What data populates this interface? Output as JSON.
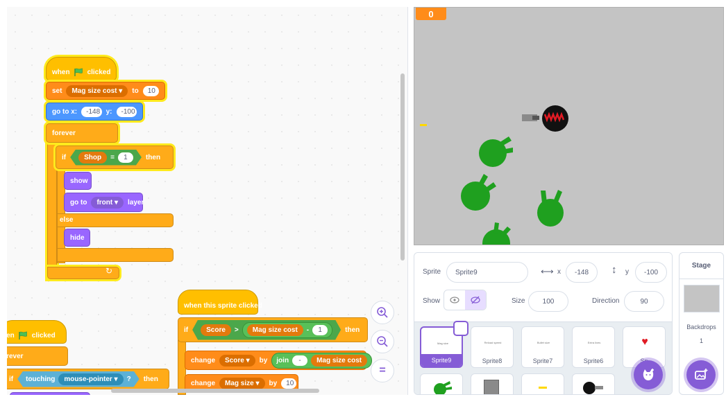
{
  "score_monitor": {
    "value": "0"
  },
  "scripts": {
    "script1": {
      "when_flag": {
        "when": "when",
        "clicked": "clicked"
      },
      "set": {
        "label": "set",
        "var": "Mag size cost ▾",
        "to": "to",
        "value": "10"
      },
      "goto": {
        "label": "go to x:",
        "x": "-148",
        "ylabel": "y:",
        "y": "-100"
      },
      "forever": "forever",
      "if": {
        "label": "if",
        "var": "Shop",
        "op": "=",
        "value": "1",
        "then": "then"
      },
      "show": "show",
      "goto_layer": {
        "label": "go to",
        "layer": "front ▾",
        "suffix": "layer"
      },
      "else": "else",
      "hide": "hide"
    },
    "script2": {
      "hat": "when this sprite clicked",
      "if": {
        "label": "if",
        "var": "Score",
        "op": ">",
        "var2": "Mag size cost",
        "op2": "-",
        "value": "1",
        "then": "then"
      },
      "change1": {
        "label": "change",
        "var": "Score ▾",
        "by": "by",
        "join": "join",
        "join_a": "-",
        "join_b": "Mag size cost"
      },
      "change2": {
        "label": "change",
        "var": "Mag size ▾",
        "by": "by",
        "value": "10"
      }
    },
    "script3": {
      "when": "hen",
      "clicked": "clicked",
      "forever": "orever",
      "if": {
        "label": "if",
        "touching": "touching",
        "target": "mouse-pointer ▾",
        "q": "?",
        "then": "then"
      }
    }
  },
  "zoom": {
    "in": "zoom-in",
    "out": "zoom-out",
    "reset": "="
  },
  "sprite_info": {
    "sprite_label": "Sprite",
    "sprite_name": "Sprite9",
    "x_label": "x",
    "x": "-148",
    "y_label": "y",
    "y": "-100",
    "show_label": "Show",
    "size_label": "Size",
    "size": "100",
    "direction_label": "Direction",
    "direction": "90"
  },
  "sprites": [
    {
      "name": "Sprite9",
      "thumb": "Mag size",
      "selected": true
    },
    {
      "name": "Sprite8",
      "thumb": "Reload speed"
    },
    {
      "name": "Sprite7",
      "thumb": "Bullet size"
    },
    {
      "name": "Sprite6",
      "thumb": "Extra lives"
    },
    {
      "name": "Sp",
      "thumb": "heart"
    }
  ],
  "stage_panel": {
    "title": "Stage",
    "backdrops_label": "Backdrops",
    "backdrops_count": "1"
  },
  "colors": {
    "events": "#ffbf00",
    "control": "#ffab19",
    "motion": "#4c97ff",
    "looks": "#9966ff",
    "variables": "#ff8c1a",
    "operators": "#59c059",
    "sensing": "#5cb1d6",
    "accent": "#855cd6",
    "stage_bg": "#c4c4c4"
  }
}
